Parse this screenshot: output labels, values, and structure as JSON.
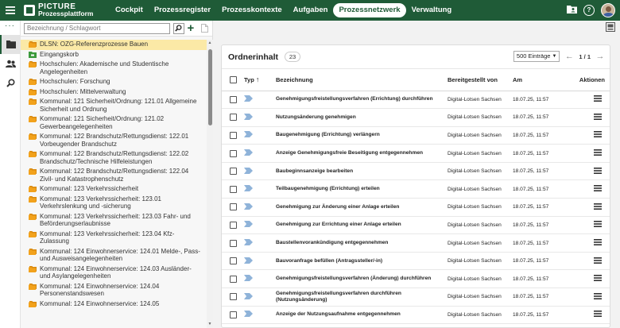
{
  "app": {
    "logo_line1": "PICTURE",
    "logo_line2": "Prozessplattform",
    "brand_color": "#1f5b37"
  },
  "nav": {
    "items": [
      {
        "label": "Cockpit",
        "active": false
      },
      {
        "label": "Prozessregister",
        "active": false
      },
      {
        "label": "Prozesskontexte",
        "active": false
      },
      {
        "label": "Aufgaben",
        "active": false
      },
      {
        "label": "Prozessnetzwerk",
        "active": true
      },
      {
        "label": "Verwaltung",
        "active": false
      }
    ]
  },
  "top_icons": [
    "folder-person-icon",
    "help-icon",
    "avatar"
  ],
  "rail": {
    "items": [
      "folder-icon",
      "users-icon",
      "search-icon"
    ]
  },
  "search": {
    "placeholder": "Bezeichnung / Schlagwort",
    "value": ""
  },
  "tree": {
    "items": [
      {
        "label": "DLSN: OZG-Referenzprozesse Bauen",
        "selected": true,
        "icon": "folder-group-icon"
      },
      {
        "label": "Eingangskorb",
        "selected": false,
        "icon": "inbox-icon"
      },
      {
        "label": "Hochschulen: Akademische und Studentische Angelegenheiten",
        "selected": false,
        "icon": "folder-group-icon"
      },
      {
        "label": "Hochschulen: Forschung",
        "selected": false,
        "icon": "folder-group-icon"
      },
      {
        "label": "Hochschulen: Mittelverwaltung",
        "selected": false,
        "icon": "folder-group-icon"
      },
      {
        "label": "Kommunal: 121 Sicherheit/Ordnung: 121.01 Allgemeine Sicherheit und Ordnung",
        "selected": false,
        "icon": "folder-group-icon"
      },
      {
        "label": "Kommunal: 121 Sicherheit/Ordnung: 121.02 Gewerbeangelegenheiten",
        "selected": false,
        "icon": "folder-group-icon"
      },
      {
        "label": "Kommunal: 122 Brandschutz/Rettungsdienst: 122.01 Vorbeugender Brandschutz",
        "selected": false,
        "icon": "folder-group-icon"
      },
      {
        "label": "Kommunal: 122 Brandschutz/Rettungsdienst: 122.02 Brandschutz/Technische Hilfeleistungen",
        "selected": false,
        "icon": "folder-group-icon"
      },
      {
        "label": "Kommunal: 122 Brandschutz/Rettungsdienst: 122.04 Zivil- und Katastrophenschutz",
        "selected": false,
        "icon": "folder-group-icon"
      },
      {
        "label": "Kommunal: 123 Verkehrssicherheit",
        "selected": false,
        "icon": "folder-group-icon"
      },
      {
        "label": "Kommunal: 123 Verkehrssicherheit: 123.01 Verkehrslenkung und -sicherung",
        "selected": false,
        "icon": "folder-group-icon"
      },
      {
        "label": "Kommunal: 123 Verkehrssicherheit: 123.03 Fahr- und Beförderungserlaubnisse",
        "selected": false,
        "icon": "folder-group-icon"
      },
      {
        "label": "Kommunal: 123 Verkehrssicherheit: 123.04 Kfz-Zulassung",
        "selected": false,
        "icon": "folder-group-icon"
      },
      {
        "label": "Kommunal: 124 Einwohnerservice: 124.01 Melde-, Pass- und Ausweisangelegenheiten",
        "selected": false,
        "icon": "folder-group-icon"
      },
      {
        "label": "Kommunal: 124 Einwohnerservice: 124.03 Ausländer- und Asylangelegenheiten",
        "selected": false,
        "icon": "folder-group-icon"
      },
      {
        "label": "Kommunal: 124 Einwohnerservice: 124.04 Personenstandswesen",
        "selected": false,
        "icon": "folder-group-icon"
      },
      {
        "label": "Kommunal: 124 Einwohnerservice: 124.05",
        "selected": false,
        "icon": "folder-group-icon"
      }
    ]
  },
  "content": {
    "title": "Ordnerinhalt",
    "count": "23",
    "page_size": "500 Einträge",
    "page_info": "1 / 1",
    "columns": {
      "type": "Typ",
      "name": "Bezeichnung",
      "provider": "Bereitgestellt von",
      "date": "Am",
      "actions": "Aktionen"
    },
    "rows": [
      {
        "name": "Genehmigungsfreistellungsverfahren (Errichtung) durchführen",
        "provider": "Digital-Lotsen Sachsen",
        "date": "18.07.25, 11:57"
      },
      {
        "name": "Nutzungsänderung genehmigen",
        "provider": "Digital-Lotsen Sachsen",
        "date": "18.07.25, 11:57"
      },
      {
        "name": "Baugenehmigung (Errichtung) verlängern",
        "provider": "Digital-Lotsen Sachsen",
        "date": "18.07.25, 11:57"
      },
      {
        "name": "Anzeige Genehmigungsfreie Beseitigung entgegennehmen",
        "provider": "Digital-Lotsen Sachsen",
        "date": "18.07.25, 11:57"
      },
      {
        "name": "Baubeginnsanzeige bearbeiten",
        "provider": "Digital-Lotsen Sachsen",
        "date": "18.07.25, 11:57"
      },
      {
        "name": "Teilbaugenehmigung (Errichtung) erteilen",
        "provider": "Digital-Lotsen Sachsen",
        "date": "18.07.25, 11:57"
      },
      {
        "name": "Genehmigung zur Änderung einer Anlage erteilen",
        "provider": "Digital-Lotsen Sachsen",
        "date": "18.07.25, 11:57"
      },
      {
        "name": "Genehmigung zur Errichtung einer Anlage erteilen",
        "provider": "Digital-Lotsen Sachsen",
        "date": "18.07.25, 11:57"
      },
      {
        "name": "Baustellenvorankündigung entgegennehmen",
        "provider": "Digital-Lotsen Sachsen",
        "date": "18.07.25, 11:57"
      },
      {
        "name": "Bauvoranfrage befüllen (Antragssteller/-in)",
        "provider": "Digital-Lotsen Sachsen",
        "date": "18.07.25, 11:57"
      },
      {
        "name": "Genehmigungsfreistellungsverfahren (Änderung) durchführen",
        "provider": "Digital-Lotsen Sachsen",
        "date": "18.07.25, 11:57"
      },
      {
        "name": "Genehmigungsfreistellungsverfahren durchführen (Nutzungsänderung)",
        "provider": "Digital-Lotsen Sachsen",
        "date": "18.07.25, 11:57"
      },
      {
        "name": "Anzeige der Nutzungsaufnahme entgegennehmen",
        "provider": "Digital-Lotsen Sachsen",
        "date": "18.07.25, 11:57"
      }
    ]
  },
  "colors": {
    "selected_tree_bg": "#fbe9a6",
    "folder_orange": "#f2a21c",
    "process_blue": "#8fb3d9"
  }
}
